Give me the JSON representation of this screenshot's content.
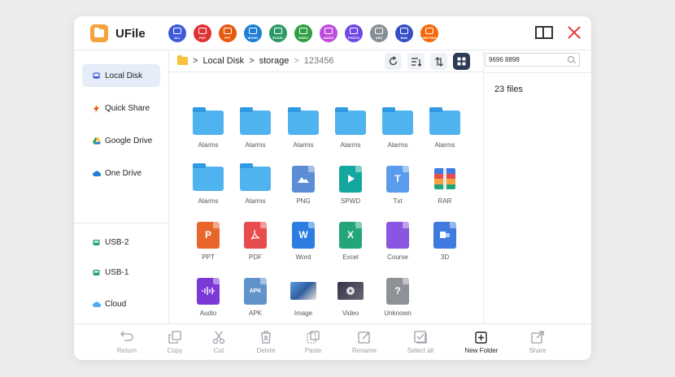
{
  "app": {
    "title": "UFile"
  },
  "categories": [
    {
      "label": "ALL",
      "color": "#3b5bdb"
    },
    {
      "label": "PDF",
      "color": "#e03131"
    },
    {
      "label": "PPT",
      "color": "#e8590c"
    },
    {
      "label": "WORD",
      "color": "#1c7ed6"
    },
    {
      "label": "EXCEL",
      "color": "#2b9a66"
    },
    {
      "label": "VIDEO",
      "color": "#2f9e44"
    },
    {
      "label": "AUDIO",
      "color": "#be4bdb"
    },
    {
      "label": "PHOTO",
      "color": "#7048e8"
    },
    {
      "label": "APK",
      "color": "#868e96"
    },
    {
      "label": "BAK",
      "color": "#364fc7"
    },
    {
      "label": "WRITING",
      "color": "#f76707"
    }
  ],
  "sidebar": {
    "items": [
      {
        "label": "Local Disk",
        "icon": "disk-icon"
      },
      {
        "label": "Quick Share",
        "icon": "lightning-icon"
      },
      {
        "label": "Google Drive",
        "icon": "google-drive-icon"
      },
      {
        "label": "One Drive",
        "icon": "cloud-icon"
      },
      {
        "label": "USB-2",
        "icon": "usb-icon"
      },
      {
        "label": "USB-1",
        "icon": "usb-icon"
      },
      {
        "label": "Cloud",
        "icon": "cloud-icon"
      }
    ]
  },
  "breadcrumb": {
    "items": [
      "Local Disk",
      "storage",
      "123456"
    ]
  },
  "search": {
    "value": "9696 8898"
  },
  "info": {
    "file_count": "23 files"
  },
  "files": [
    {
      "name": "Alarms",
      "type": "folder"
    },
    {
      "name": "Alarms",
      "type": "folder"
    },
    {
      "name": "Alarms",
      "type": "folder"
    },
    {
      "name": "Alarms",
      "type": "folder"
    },
    {
      "name": "Alarms",
      "type": "folder"
    },
    {
      "name": "Alarms",
      "type": "folder"
    },
    {
      "name": "Alarms",
      "type": "folder"
    },
    {
      "name": "Alarms",
      "type": "folder"
    },
    {
      "name": "PNG",
      "type": "png",
      "color": "#5b8dd6"
    },
    {
      "name": "SPWD",
      "type": "spwd",
      "color": "#14a7a0"
    },
    {
      "name": "Txt",
      "type": "txt",
      "color": "#5b9bec",
      "glyph": "T"
    },
    {
      "name": "RAR",
      "type": "rar"
    },
    {
      "name": "PPT",
      "type": "ppt",
      "color": "#e8662c",
      "glyph": "P"
    },
    {
      "name": "PDF",
      "type": "pdf",
      "color": "#e84c4c",
      "glyph": "✦"
    },
    {
      "name": "Word",
      "type": "word",
      "color": "#2b7de0",
      "glyph": "W"
    },
    {
      "name": "Excel",
      "type": "excel",
      "color": "#22a57a",
      "glyph": "X"
    },
    {
      "name": "Course",
      "type": "course",
      "color": "#8a55e0"
    },
    {
      "name": "3D",
      "type": "3d",
      "color": "#3f7ae0"
    },
    {
      "name": "Audio",
      "type": "audio",
      "color": "#7b3ad8"
    },
    {
      "name": "APK",
      "type": "apk",
      "color": "#5f93c9",
      "glyph": "APK"
    },
    {
      "name": "Image",
      "type": "image"
    },
    {
      "name": "Video",
      "type": "video"
    },
    {
      "name": "Unknown",
      "type": "unknown",
      "color": "#8e9297",
      "glyph": "?"
    }
  ],
  "bottombar": {
    "items": [
      "Return",
      "Copy",
      "Cut",
      "Delete",
      "Paste",
      "Rename",
      "Select all",
      "New Folder",
      "Share"
    ]
  }
}
